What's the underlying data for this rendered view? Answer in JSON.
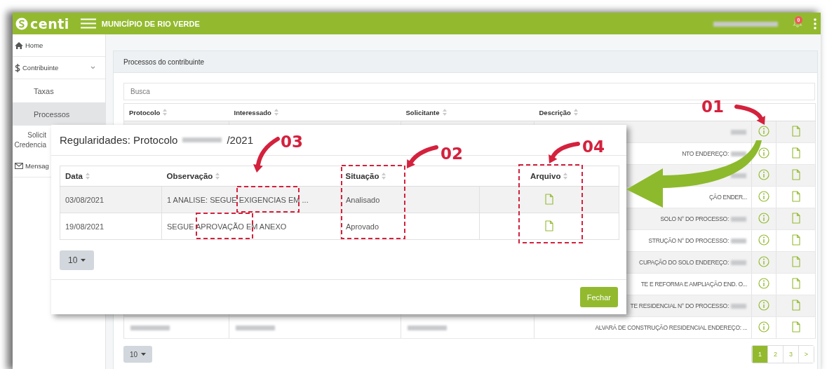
{
  "topbar": {
    "logo_text": "centi",
    "title": "MUNICÍPIO DE RIO VERDE",
    "user_name": [
      {
        "kind": "redacted"
      }
    ],
    "notification_count": "0"
  },
  "sidebar": {
    "items": [
      {
        "kind": "home",
        "label": "Home",
        "selected": false
      },
      {
        "kind": "dollar",
        "label": "Contribuinte",
        "selected": false,
        "expanded": true,
        "children": [
          {
            "lines": [
              "Taxas"
            ],
            "selected": false
          },
          {
            "lines": [
              "Processos"
            ],
            "selected": true
          },
          {
            "lines": [
              "Solicit",
              "Credencia"
            ],
            "selected": false
          }
        ]
      },
      {
        "kind": "mail",
        "label": "Mensag",
        "selected": false
      }
    ]
  },
  "panel": {
    "title": "Processos do contribuinte",
    "search": {
      "placeholder": "Busca"
    },
    "table": {
      "columns": [
        "Protocolo",
        "Interessado",
        "Solicitante",
        "Descrição"
      ],
      "rows": [
        {
          "description": [
            {
              "kind": "redacted"
            }
          ]
        },
        {
          "description": [
            {
              "kind": "text",
              "text": "NTO ENDEREÇO:"
            },
            {
              "kind": "redacted"
            }
          ]
        },
        {
          "description": [
            {
              "kind": "redacted"
            }
          ]
        },
        {
          "description": [
            {
              "kind": "text",
              "text": "ÇÃO ENDER..."
            }
          ]
        },
        {
          "description": [
            {
              "kind": "text",
              "text": "SOLO N° DO PROCESSO:"
            },
            {
              "kind": "redacted"
            }
          ]
        },
        {
          "description": [
            {
              "kind": "text",
              "text": "STRUÇÃO N° DO PROCESSO:"
            },
            {
              "kind": "redacted"
            }
          ]
        },
        {
          "description": [
            {
              "kind": "text",
              "text": "CUPAÇÃO DO SOLO ENDEREÇO:"
            },
            {
              "kind": "redacted"
            }
          ]
        },
        {
          "description": [
            {
              "kind": "text",
              "text": "TE E REFORMA E AMPLIAÇÃO END. O..."
            }
          ]
        },
        {
          "description": [
            {
              "kind": "text",
              "text": "TE RESIDENCIAL N° DO PROCESSO:"
            },
            {
              "kind": "redacted"
            }
          ]
        },
        {
          "protocol": [
            {
              "kind": "redacted"
            }
          ],
          "interested": [
            {
              "kind": "redacted"
            }
          ],
          "requester": [
            {
              "kind": "redacted"
            }
          ],
          "description": [
            {
              "kind": "text",
              "text": "ALVARÁ DE CONSTRUÇÃO RESIDENCIAL ENDEREÇO: ..."
            }
          ]
        }
      ]
    },
    "page_size": "10",
    "pagination": [
      {
        "label": "1",
        "selected": true
      },
      {
        "label": "2",
        "selected": false
      },
      {
        "label": "3",
        "selected": false
      },
      {
        "label": ">",
        "selected": false
      }
    ]
  },
  "dialog": {
    "title": [
      {
        "kind": "text",
        "text": "Regularidades: Protocolo"
      },
      {
        "kind": "redacted"
      },
      {
        "kind": "text",
        "text": "/2021"
      }
    ],
    "columns": [
      "Data",
      "Observação",
      "Situação",
      "Arquivo"
    ],
    "rows": [
      {
        "date": "03/08/2021",
        "note": "1 ANALISE: SEGUE EXIGENCIAS EM ...",
        "status": "Analisado"
      },
      {
        "date": "19/08/2021",
        "note": "SEGUE APROVAÇÃO EM ANEXO",
        "status": "Aprovado"
      }
    ],
    "page_size": "10",
    "close_button": "Fechar"
  },
  "annotations": [
    {
      "kind": "callout",
      "label": "01"
    },
    {
      "kind": "callout",
      "label": "02"
    },
    {
      "kind": "callout",
      "label": "03"
    },
    {
      "kind": "callout",
      "label": "04"
    },
    {
      "kind": "pointer"
    }
  ]
}
